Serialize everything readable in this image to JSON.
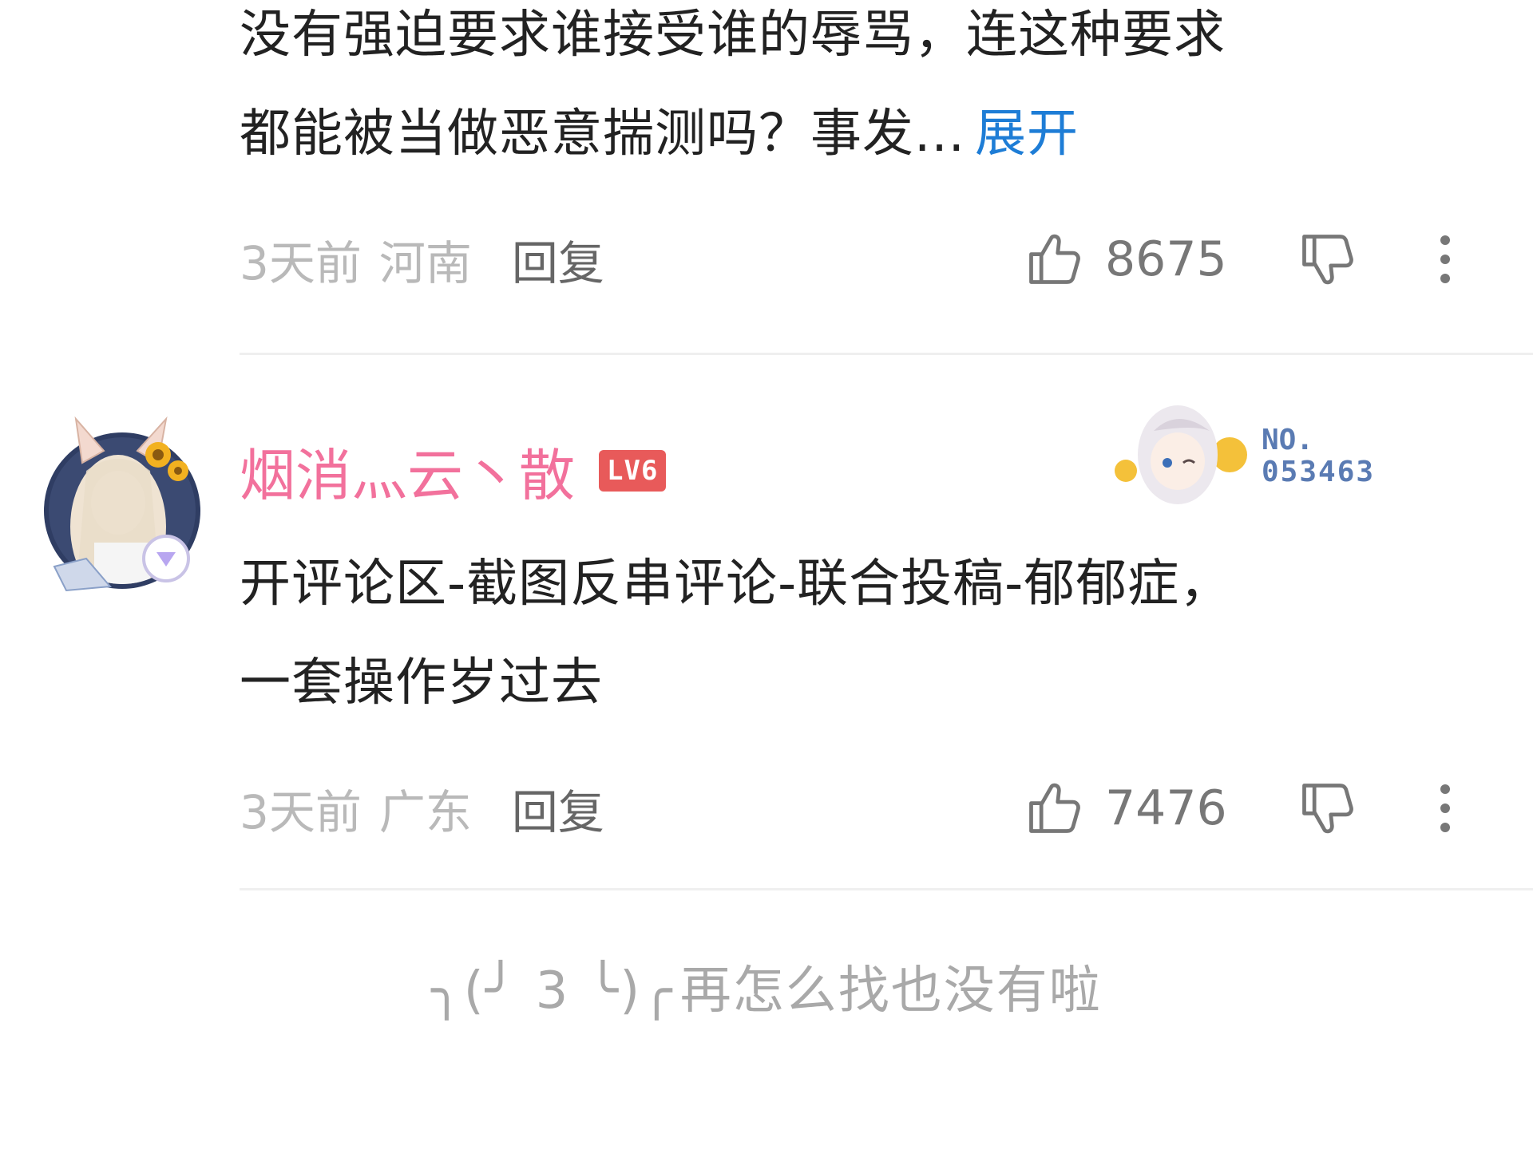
{
  "comment1": {
    "text_line1": "没有强迫要求谁接受谁的辱骂，连这种要求",
    "text_line2": "都能被当做恶意揣测吗？事发...",
    "expand_label": "展开",
    "time": "3天前",
    "region": "河南",
    "reply_label": "回复",
    "likes": "8675"
  },
  "comment2": {
    "username": "烟消灬云丶散",
    "level": "LV6",
    "fan_badge": {
      "line1": "NO.",
      "line2": "053463"
    },
    "text_line1": "开评论区-截图反串评论-联合投稿-郁郁症，",
    "text_line2": "一套操作岁过去",
    "time": "3天前",
    "region": "广东",
    "reply_label": "回复",
    "likes": "7476"
  },
  "end_note": {
    "kaomoji": "╮(╯ 3 ╰)╭",
    "text": "再怎么找也没有啦"
  },
  "colors": {
    "username": "#f2719c",
    "link": "#1e7dd6",
    "level_badge": "#e85a5a",
    "meta_gray": "#b9b9b9"
  },
  "icons": [
    "thumbs-up-icon",
    "thumbs-down-icon",
    "more-vertical-icon"
  ]
}
